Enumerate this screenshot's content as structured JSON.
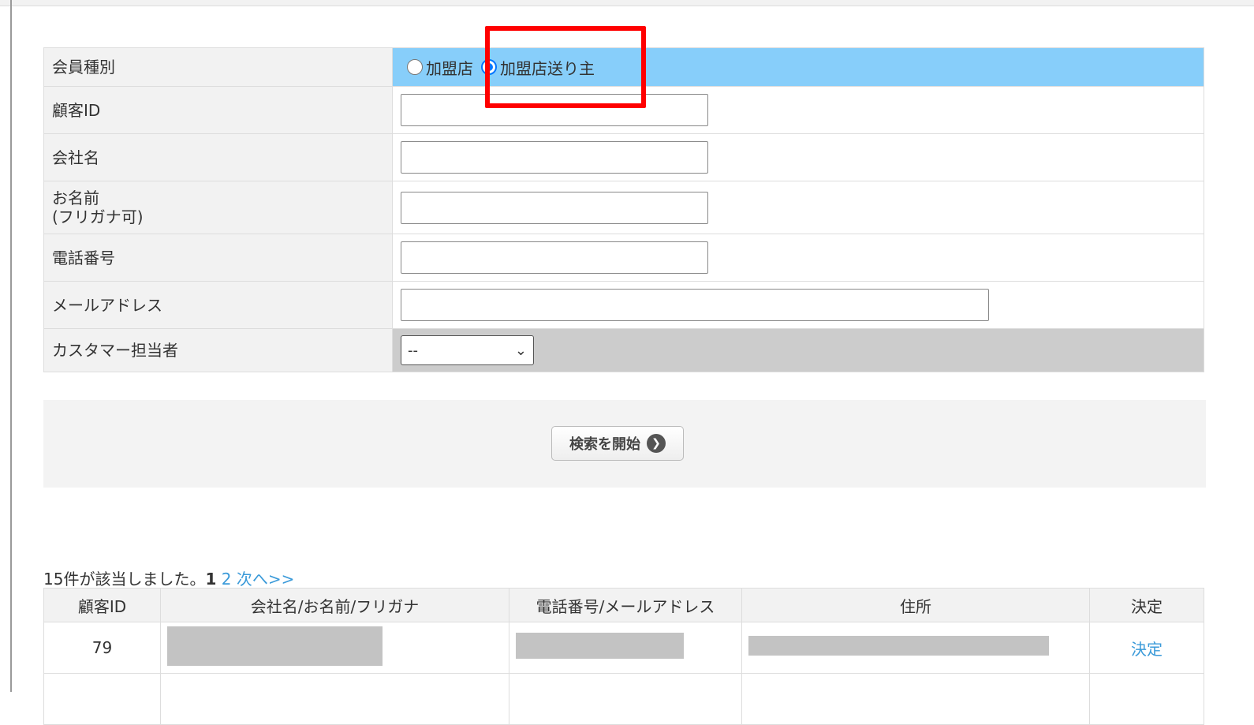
{
  "form": {
    "member_type": {
      "label": "会員種別",
      "options": [
        "加盟店",
        "加盟店送り主"
      ],
      "selected": "加盟店送り主"
    },
    "customer_id": {
      "label": "顧客ID",
      "value": ""
    },
    "company": {
      "label": "会社名",
      "value": ""
    },
    "name": {
      "label": "お名前\n(フリガナ可)",
      "label_line1": "お名前",
      "label_line2": "(フリガナ可)",
      "value": ""
    },
    "phone": {
      "label": "電話番号",
      "value": ""
    },
    "email": {
      "label": "メールアドレス",
      "value": ""
    },
    "staff": {
      "label": "カスタマー担当者",
      "selected": "--"
    }
  },
  "search": {
    "button": "検索を開始"
  },
  "results": {
    "count_text": "15件が該当しました。",
    "current_page": "1",
    "page2": "2",
    "next": "次へ>>",
    "headers": [
      "顧客ID",
      "会社名/お名前/フリガナ",
      "電話番号/メールアドレス",
      "住所",
      "決定"
    ],
    "rows": [
      {
        "id": "79",
        "action": "決定"
      }
    ]
  },
  "colors": {
    "highlight": "#ff0000",
    "selected_row": "#87cefa",
    "link": "#3a9ad9"
  }
}
